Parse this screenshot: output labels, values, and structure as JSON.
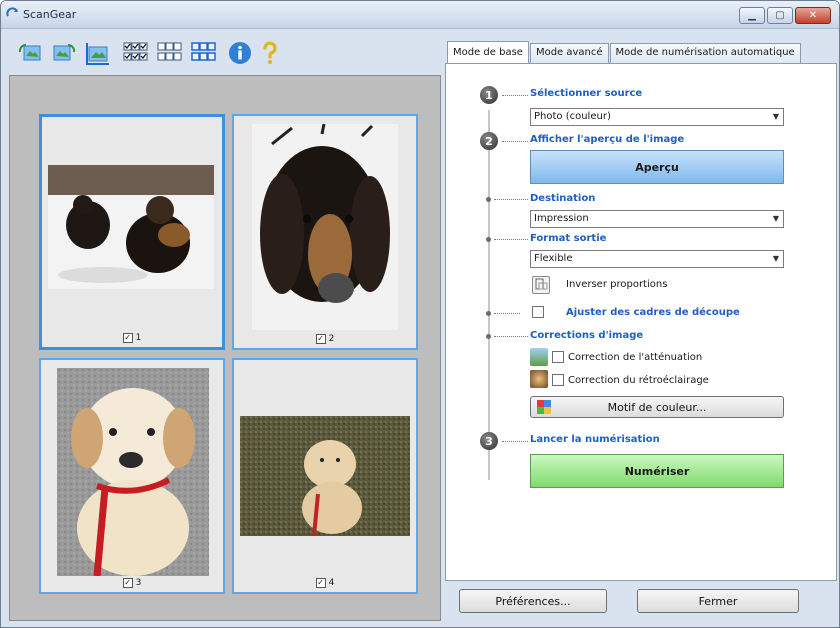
{
  "window": {
    "title": "ScanGear"
  },
  "toolbar": {
    "buttons": [
      {
        "icon": "rotate-left-icon"
      },
      {
        "icon": "rotate-right-icon"
      },
      {
        "icon": "auto-crop-icon"
      },
      {
        "icon": "check-all-icon"
      },
      {
        "icon": "uncheck-all-icon"
      },
      {
        "icon": "select-all-icon"
      },
      {
        "icon": "info-icon"
      },
      {
        "icon": "help-icon"
      }
    ]
  },
  "thumbnails": [
    {
      "label": "1",
      "checked": true
    },
    {
      "label": "2",
      "checked": true
    },
    {
      "label": "3",
      "checked": true
    },
    {
      "label": "4",
      "checked": true
    }
  ],
  "tabs": [
    {
      "label": "Mode de base"
    },
    {
      "label": "Mode avancé"
    },
    {
      "label": "Mode de numérisation automatique"
    }
  ],
  "steps": {
    "step1": {
      "num": "1",
      "title": "Sélectionner source",
      "value": "Photo (couleur)"
    },
    "step2": {
      "num": "2",
      "title": "Afficher l'aperçu de l'image",
      "button": "Aperçu"
    },
    "destination": {
      "title": "Destination",
      "value": "Impression"
    },
    "format": {
      "title": "Format sortie",
      "value": "Flexible",
      "invert": "Inverser proportions"
    },
    "crop": {
      "title": "Ajuster des cadres de découpe"
    },
    "corrections": {
      "title": "Corrections d'image",
      "fade": "Correction de l'atténuation",
      "backlight": "Correction du rétroéclairage",
      "color_button": "Motif de couleur..."
    },
    "step3": {
      "num": "3",
      "title": "Lancer la numérisation",
      "button": "Numériser"
    }
  },
  "footer": {
    "preferences": "Préférences...",
    "close": "Fermer"
  },
  "colors": {
    "accent_blue": "#1f5fbf",
    "preview_blue": "#7fb9ee",
    "scan_green": "#7edb6b"
  }
}
